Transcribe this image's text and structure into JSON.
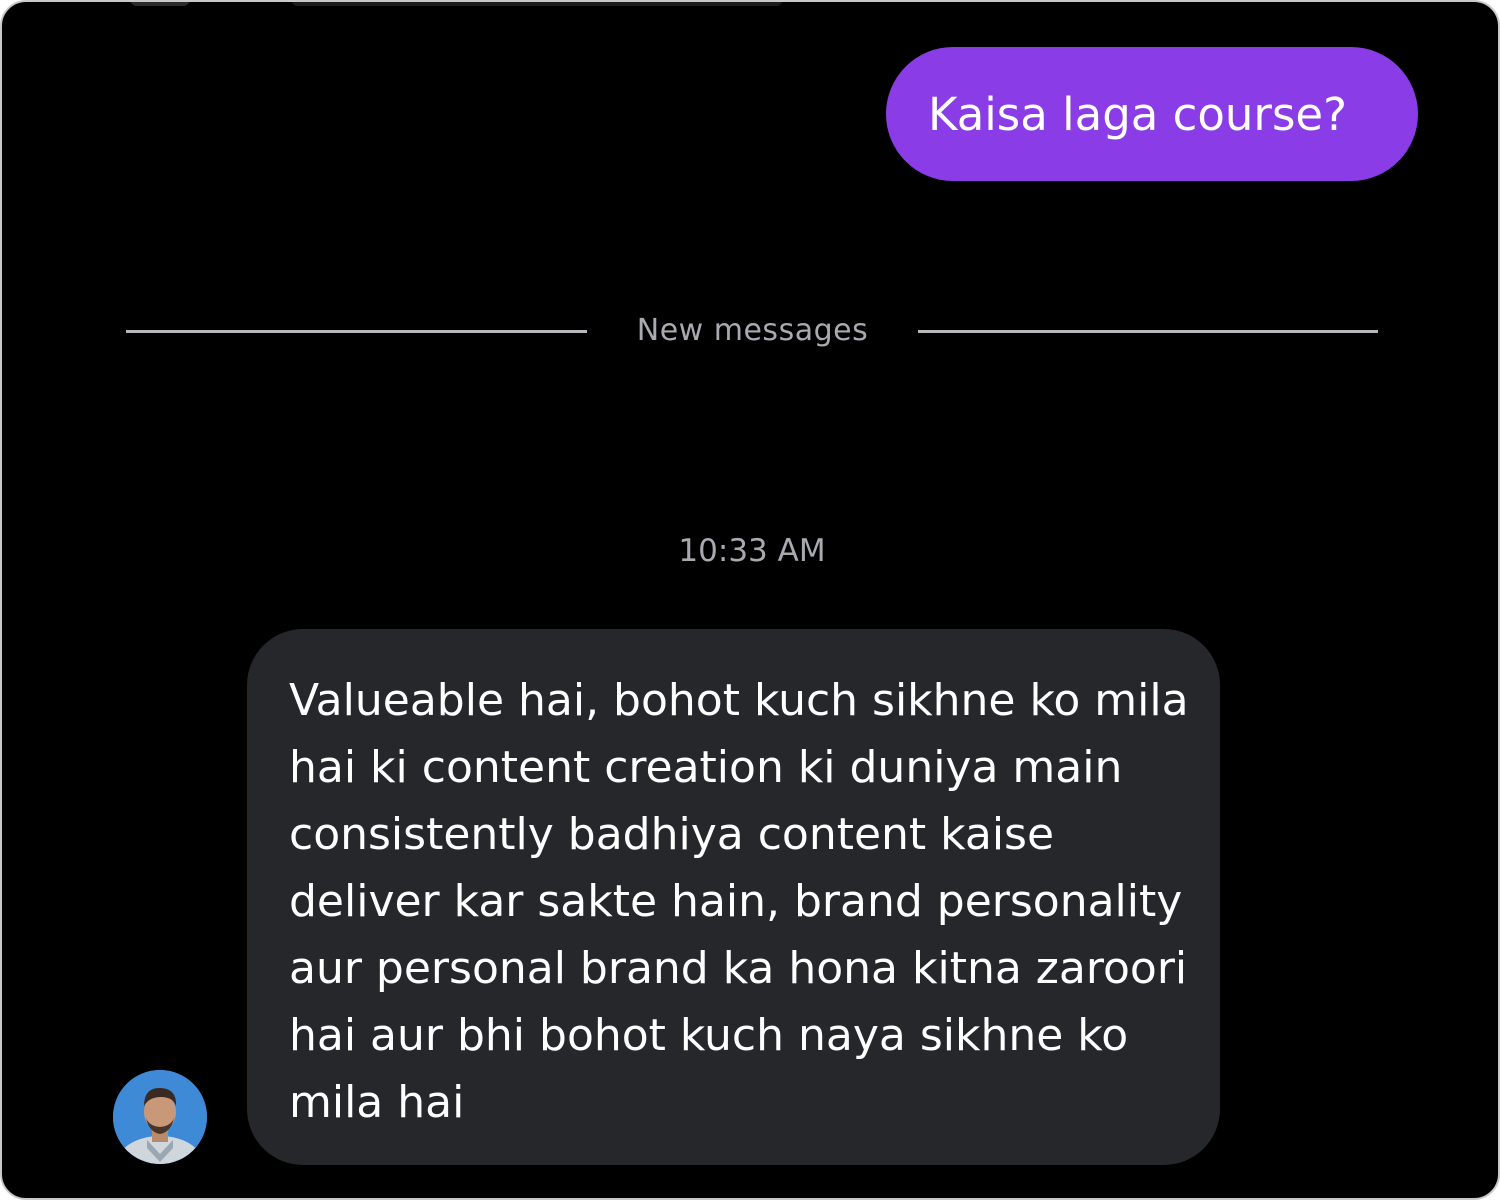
{
  "chat": {
    "sent_message": "Kaisa laga course?",
    "divider_label": "New messages",
    "timestamp": "10:33 AM",
    "received_message": "Valueable hai, bohot kuch sikhne ko mila hai ki content creation ki duniya main consistently badhiya content kaise deliver kar sakte hain, brand personality aur personal brand ka hona kitna zaroori hai aur bhi bohot kuch naya sikhne ko mila hai"
  },
  "colors": {
    "background": "#000000",
    "sent_bubble": "#8a3de6",
    "received_bubble": "#26272b",
    "muted_text": "#a9a9b1"
  },
  "icons": {
    "sender_avatar": "avatar-photo"
  }
}
